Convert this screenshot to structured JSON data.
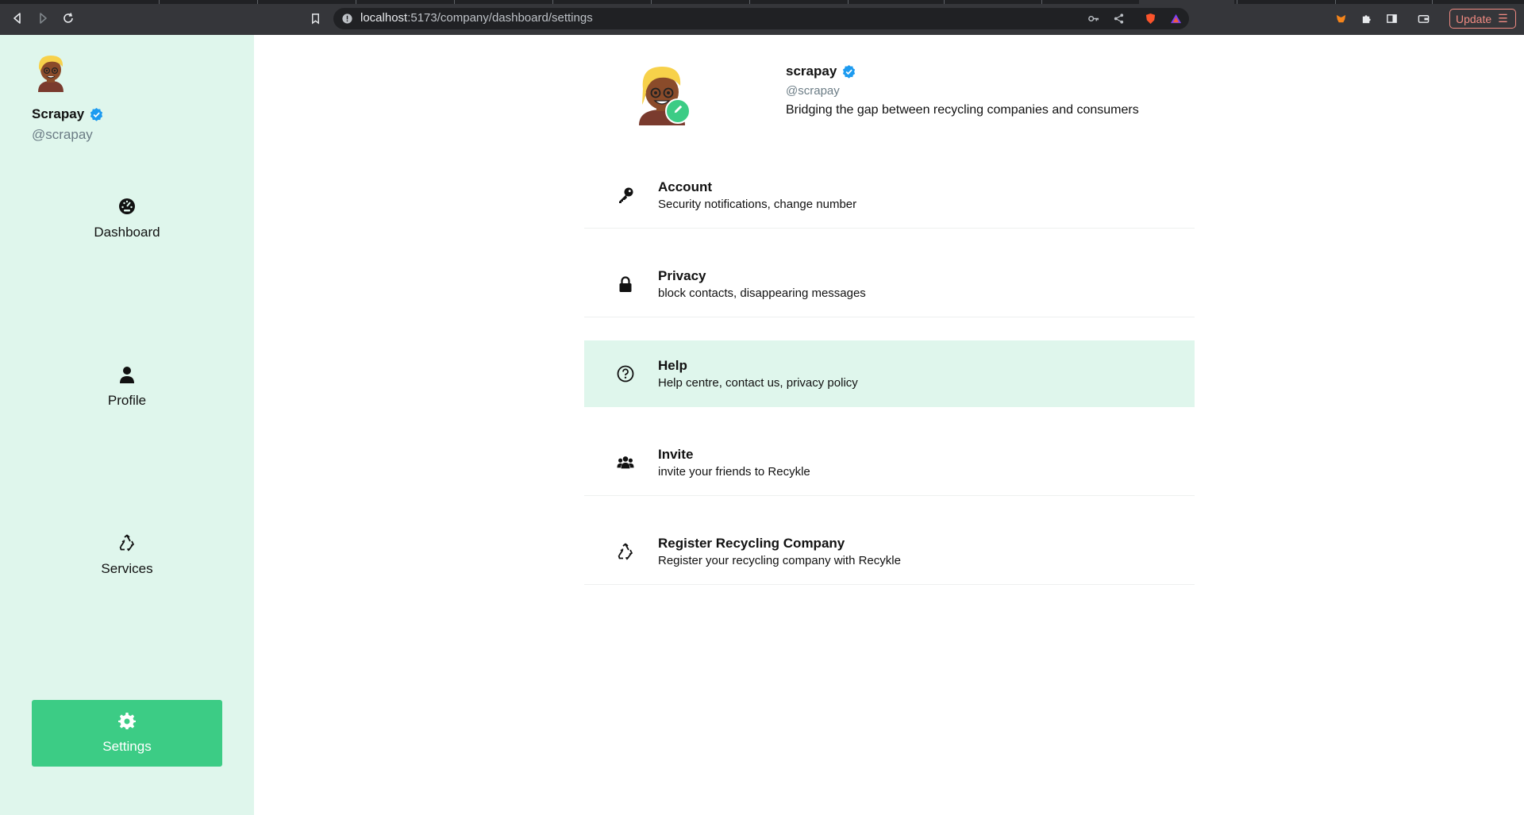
{
  "browser": {
    "url_host": "localhost",
    "url_path": ":5173/company/dashboard/settings",
    "update_label": "Update"
  },
  "sidebar": {
    "name": "Scrapay",
    "handle": "@scrapay",
    "items": [
      {
        "label": "Dashboard",
        "icon": "dashboard-gauge-icon"
      },
      {
        "label": "Profile",
        "icon": "person-icon"
      },
      {
        "label": "Services",
        "icon": "recycle-icon"
      },
      {
        "label": "Settings",
        "icon": "gear-icon"
      }
    ]
  },
  "profile": {
    "name": "scrapay",
    "handle": "@scrapay",
    "bio": "Bridging the gap between recycling companies and consumers"
  },
  "settings": [
    {
      "title": "Account",
      "subtitle": "Security notifications, change number",
      "icon": "key-icon"
    },
    {
      "title": "Privacy",
      "subtitle": "block contacts, disappearing messages",
      "icon": "lock-icon"
    },
    {
      "title": "Help",
      "subtitle": "Help centre, contact us, privacy policy",
      "icon": "help-circle-icon"
    },
    {
      "title": "Invite",
      "subtitle": "invite your friends to Recykle",
      "icon": "group-icon"
    },
    {
      "title": "Register Recycling Company",
      "subtitle": "Register your recycling company with Recykle",
      "icon": "recycle-icon"
    }
  ],
  "colors": {
    "accent": "#3ccc85",
    "sidebar_bg": "#dff6ec",
    "verified": "#1d9bf0"
  }
}
